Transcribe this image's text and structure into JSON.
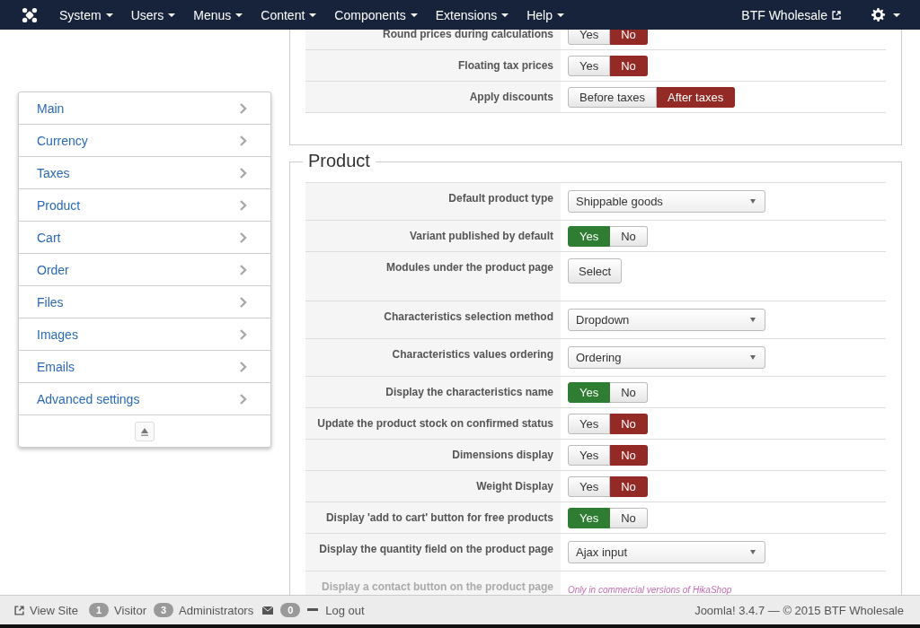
{
  "navbar": {
    "menus": [
      {
        "label": "System"
      },
      {
        "label": "Users"
      },
      {
        "label": "Menus"
      },
      {
        "label": "Content"
      },
      {
        "label": "Components"
      },
      {
        "label": "Extensions"
      },
      {
        "label": "Help"
      }
    ],
    "site_link": "BTF Wholesale"
  },
  "sidebar": {
    "items": [
      {
        "label": "Main"
      },
      {
        "label": "Currency"
      },
      {
        "label": "Taxes"
      },
      {
        "label": "Product"
      },
      {
        "label": "Cart"
      },
      {
        "label": "Order"
      },
      {
        "label": "Files"
      },
      {
        "label": "Images"
      },
      {
        "label": "Emails"
      },
      {
        "label": "Advanced settings"
      }
    ]
  },
  "sections": [
    {
      "rows": [
        {
          "label": "Round prices during calculations",
          "kind": "toggle",
          "options": [
            {
              "label": "Yes",
              "selected": false
            },
            {
              "label": "No",
              "selected": true,
              "color": "#942a25"
            }
          ]
        },
        {
          "label": "Floating tax prices",
          "kind": "toggle",
          "options": [
            {
              "label": "Yes",
              "selected": false
            },
            {
              "label": "No",
              "selected": true,
              "color": "#942a25"
            }
          ]
        },
        {
          "label": "Apply discounts",
          "kind": "toggle",
          "options": [
            {
              "label": "Before taxes",
              "selected": false
            },
            {
              "label": "After taxes",
              "selected": true,
              "color": "#942a25"
            }
          ]
        }
      ]
    },
    {
      "title": "Product",
      "rows": [
        {
          "label": "Default product type",
          "kind": "select",
          "value": "Shippable goods"
        },
        {
          "label": "Variant published by default",
          "kind": "toggle",
          "options": [
            {
              "label": "Yes",
              "selected": true,
              "color": "#2f7d32"
            },
            {
              "label": "No",
              "selected": false
            }
          ]
        },
        {
          "label": "Modules under the product page",
          "kind": "button",
          "value": "Select"
        },
        {
          "label": "Characteristics selection method",
          "kind": "select",
          "value": "Dropdown"
        },
        {
          "label": "Characteristics values ordering",
          "kind": "select",
          "value": "Ordering"
        },
        {
          "label": "Display the characteristics name",
          "kind": "toggle",
          "options": [
            {
              "label": "Yes",
              "selected": true,
              "color": "#2f7d32"
            },
            {
              "label": "No",
              "selected": false
            }
          ]
        },
        {
          "label": "Update the product stock on confirmed status",
          "kind": "toggle",
          "options": [
            {
              "label": "Yes",
              "selected": false
            },
            {
              "label": "No",
              "selected": true,
              "color": "#942a25"
            }
          ]
        },
        {
          "label": "Dimensions display",
          "kind": "toggle",
          "options": [
            {
              "label": "Yes",
              "selected": false
            },
            {
              "label": "No",
              "selected": true,
              "color": "#942a25"
            }
          ]
        },
        {
          "label": "Weight Display",
          "kind": "toggle",
          "options": [
            {
              "label": "Yes",
              "selected": false
            },
            {
              "label": "No",
              "selected": true,
              "color": "#942a25"
            }
          ]
        },
        {
          "label": "Display 'add to cart' button for free products",
          "kind": "toggle",
          "options": [
            {
              "label": "Yes",
              "selected": true,
              "color": "#2f7d32"
            },
            {
              "label": "No",
              "selected": false
            }
          ]
        },
        {
          "label": "Display the quantity field on the product page",
          "kind": "select",
          "value": "Ajax input"
        },
        {
          "label": "Display a contact button on the product page",
          "kind": "note",
          "disabled": true,
          "value": "Only in commercial versions of HikaShop"
        }
      ]
    }
  ],
  "status_bar": {
    "view_site": "View Site",
    "visitors": "1",
    "visitor_label": "Visitor",
    "admins": "3",
    "admin_label": "Administrators",
    "messages": "0",
    "logout": "Log out",
    "version": "Joomla! 3.4.7 — © 2015 BTF Wholesale"
  }
}
